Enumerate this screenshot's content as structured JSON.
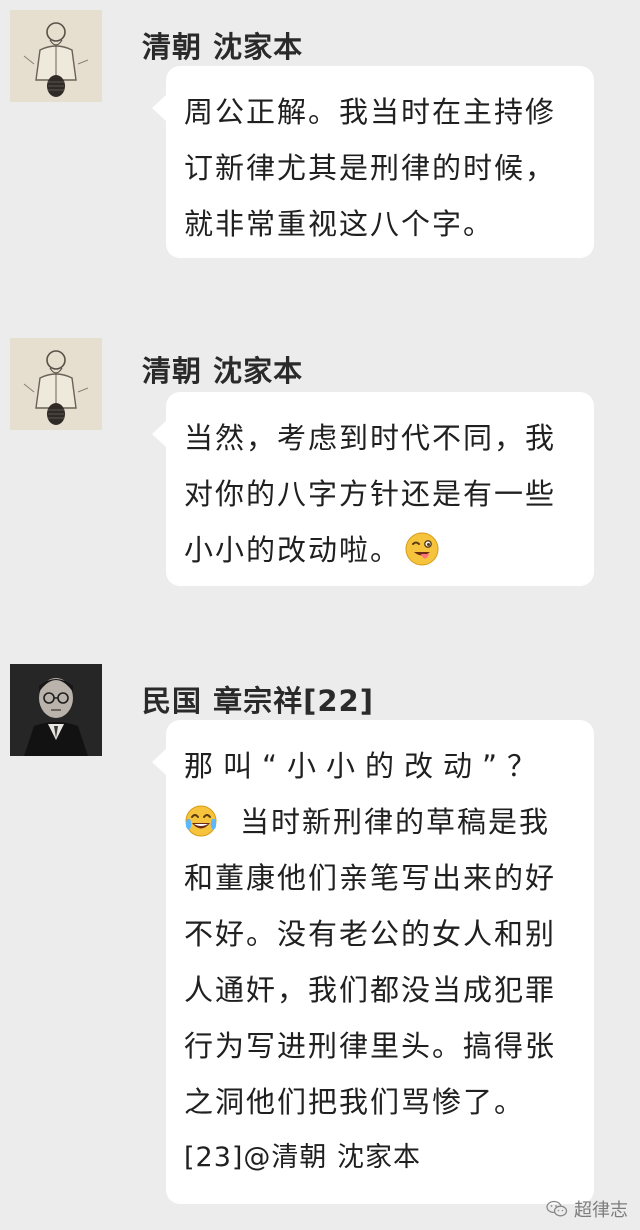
{
  "messages": [
    {
      "sender": "清朝 沈家本",
      "lines": [
        "周公正解。我当时在主持修",
        "订新律尤其是刑律的时候，",
        "就非常重视这八个字。"
      ]
    },
    {
      "sender": "清朝 沈家本",
      "lines": [
        "当然，考虑到时代不同，我",
        "对你的八字方针还是有一些",
        "小小的改动啦。"
      ],
      "emoji": "winking-tongue-emoji"
    },
    {
      "sender": "民国 章宗祥[22]",
      "lines": [
        "那叫“小小的改动”？",
        "当时新刑律的草稿是我",
        "和董康他们亲笔写出来的好",
        "不好。没有老公的女人和别",
        "人通奸，我们都没当成犯罪",
        "行为写进刑律里头。搞得张",
        "之洞他们把我们骂惨了。",
        "[23]@清朝 沈家本"
      ],
      "emoji": "tears-of-joy-emoji"
    }
  ],
  "watermark": "超律志",
  "colors": {
    "background": "#ececec",
    "bubble": "#ffffff",
    "text": "#202020"
  }
}
